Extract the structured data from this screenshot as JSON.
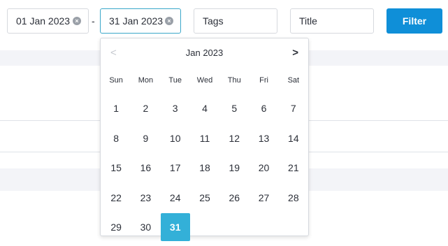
{
  "filters": {
    "date_from": "01 Jan 2023",
    "date_to": "31 Jan 2023",
    "separator": "-",
    "tags_placeholder": "Tags",
    "title_placeholder": "Title",
    "filter_button": "Filter"
  },
  "calendar": {
    "prev": "<",
    "next": ">",
    "month_label": "Jan 2023",
    "weekdays": [
      "Sun",
      "Mon",
      "Tue",
      "Wed",
      "Thu",
      "Fri",
      "Sat"
    ],
    "weeks": [
      [
        "1",
        "2",
        "3",
        "4",
        "5",
        "6",
        "7"
      ],
      [
        "8",
        "9",
        "10",
        "11",
        "12",
        "13",
        "14"
      ],
      [
        "15",
        "16",
        "17",
        "18",
        "19",
        "20",
        "21"
      ],
      [
        "22",
        "23",
        "24",
        "25",
        "26",
        "27",
        "28"
      ],
      [
        "29",
        "30",
        "31",
        "",
        "",
        "",
        ""
      ]
    ],
    "selected_day": "31"
  },
  "colors": {
    "accent": "#0f8fd8",
    "selected_day": "#33b0d8",
    "focus_border": "#3aa7c9"
  }
}
